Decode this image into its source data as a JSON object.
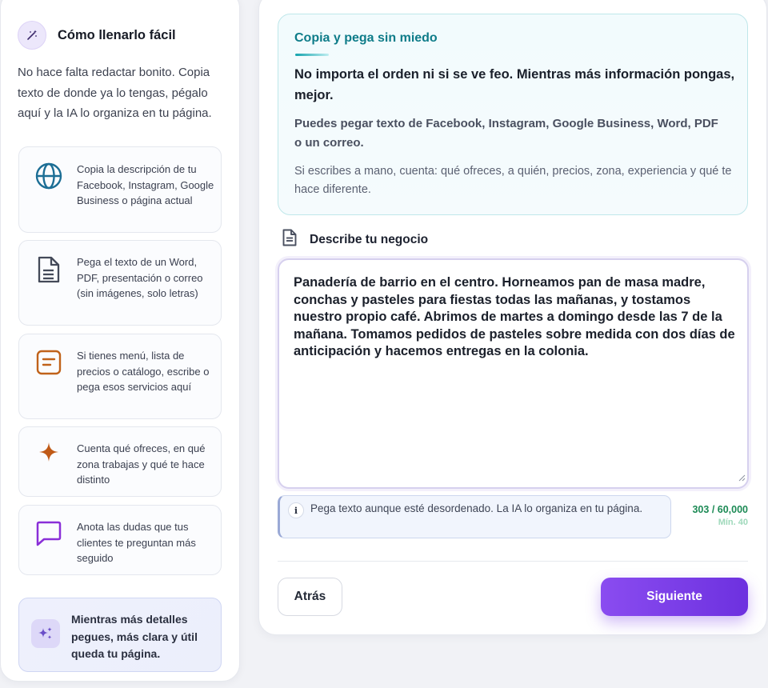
{
  "sidebar": {
    "title": "Cómo llenarlo fácil",
    "intro": "No hace falta redactar bonito. Copia texto de donde ya lo tengas, pégalo aquí y la IA lo organiza en tu página.",
    "tips": [
      {
        "icon": "globe-icon",
        "text": "Copia la descripción de tu Facebook, Instagram, Google Business o página actual"
      },
      {
        "icon": "document-icon",
        "text": "Pega el texto de un Word, PDF, presentación o correo (sin imágenes, solo letras)"
      },
      {
        "icon": "menu-list-icon",
        "text": "Si tienes menú, lista de precios o catálogo, escribe o pega esos servicios aquí"
      },
      {
        "icon": "sparkle-icon",
        "text": "Cuenta qué ofreces, en qué zona trabajas y qué te hace distinto"
      },
      {
        "icon": "chat-bubble-icon",
        "text": "Anota las dudas que tus clientes te preguntan más seguido"
      }
    ],
    "summary": "Mientras más detalles pegues, más clara y útil queda tu página."
  },
  "info": {
    "title": "Copia y pega sin miedo",
    "main": "No importa el orden ni si se ve feo. Mientras más información pongas, mejor.",
    "sub": "Puedes pegar texto de Facebook, Instagram, Google Business, Word, PDF o un correo.",
    "note": "Si escribes a mano, cuenta: qué ofreces, a quién, precios, zona, experiencia y qué te hace diferente."
  },
  "field": {
    "label": "Describe tu negocio",
    "value": "Panadería de barrio en el centro. Horneamos pan de masa madre, conchas y pasteles para fiestas todas las mañanas, y tostamos nuestro propio café. Abrimos de martes a domingo desde las 7 de la mañana. Tomamos pedidos de pasteles sobre medida con dos días de anticipación y hacemos entregas en la colonia.",
    "hint": "Pega texto aunque esté desordenado. La IA lo organiza en tu página.",
    "hint_icon": "i",
    "counter": "303 / 60,000",
    "min": "Mín. 40"
  },
  "actions": {
    "back": "Atrás",
    "next": "Siguiente"
  },
  "colors": {
    "accent": "#7c3aed",
    "teal": "#0e7c89",
    "counter_green": "#1c8a55"
  }
}
